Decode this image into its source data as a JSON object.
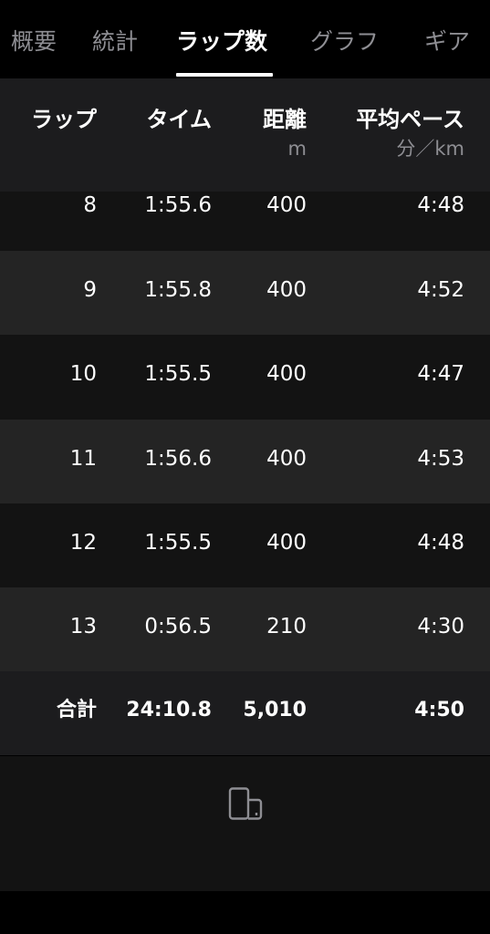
{
  "tabs": [
    {
      "label": "概要"
    },
    {
      "label": "統計"
    },
    {
      "label": "ラップ数"
    },
    {
      "label": "グラフ"
    },
    {
      "label": "ギア"
    }
  ],
  "active_tab": "ラップ数",
  "table": {
    "columns": [
      {
        "title": "ラップ",
        "unit": ""
      },
      {
        "title": "タイム",
        "unit": ""
      },
      {
        "title": "距離",
        "unit": "m"
      },
      {
        "title": "平均ペース",
        "unit": "分／km"
      }
    ],
    "rows": [
      {
        "lap": "8",
        "time": "1:55.6",
        "distance": "400",
        "pace": "4:48"
      },
      {
        "lap": "9",
        "time": "1:55.8",
        "distance": "400",
        "pace": "4:52"
      },
      {
        "lap": "10",
        "time": "1:55.5",
        "distance": "400",
        "pace": "4:47"
      },
      {
        "lap": "11",
        "time": "1:56.6",
        "distance": "400",
        "pace": "4:53"
      },
      {
        "lap": "12",
        "time": "1:55.5",
        "distance": "400",
        "pace": "4:48"
      },
      {
        "lap": "13",
        "time": "0:56.5",
        "distance": "210",
        "pace": "4:30"
      }
    ],
    "total": {
      "label": "合計",
      "time": "24:10.8",
      "distance": "5,010",
      "pace": "4:50"
    }
  },
  "footer": {
    "icon": "device-sync-icon"
  }
}
